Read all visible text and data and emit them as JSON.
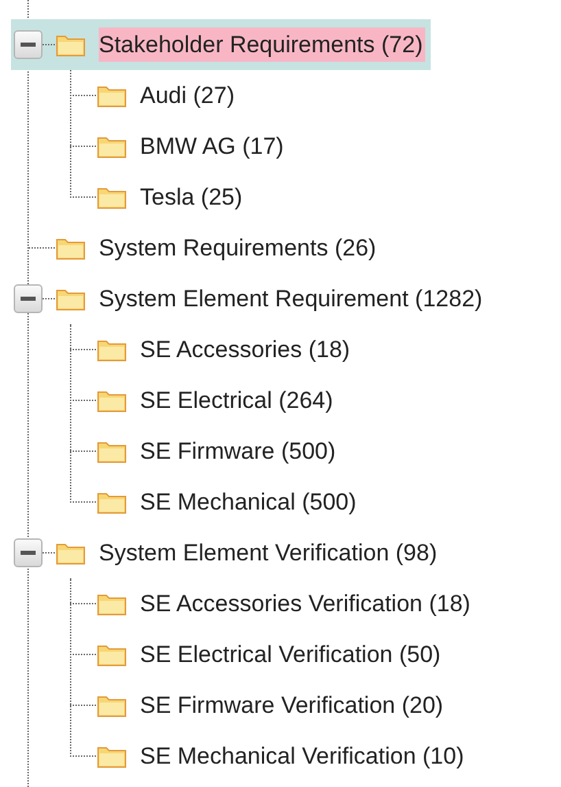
{
  "tree": [
    {
      "label": "Stakeholder Requirements (72)",
      "selected": true,
      "expanded": true,
      "children": [
        {
          "label": "Audi (27)",
          "selected": false
        },
        {
          "label": "BMW AG (17)",
          "selected": false
        },
        {
          "label": "Tesla (25)",
          "selected": false
        }
      ]
    },
    {
      "label": "System Requirements (26)",
      "selected": false
    },
    {
      "label": "System Element Requirement (1282)",
      "selected": false,
      "expanded": true,
      "children": [
        {
          "label": "SE Accessories (18)",
          "selected": false
        },
        {
          "label": "SE Electrical (264)",
          "selected": false
        },
        {
          "label": "SE Firmware (500)",
          "selected": false
        },
        {
          "label": "SE Mechanical (500)",
          "selected": false
        }
      ]
    },
    {
      "label": "System Element Verification (98)",
      "selected": false,
      "expanded": true,
      "children": [
        {
          "label": "SE Accessories Verification (18)",
          "selected": false
        },
        {
          "label": "SE Electrical Verification (50)",
          "selected": false
        },
        {
          "label": "SE Firmware Verification (20)",
          "selected": false
        },
        {
          "label": "SE Mechanical Verification (10)",
          "selected": false
        }
      ]
    }
  ]
}
